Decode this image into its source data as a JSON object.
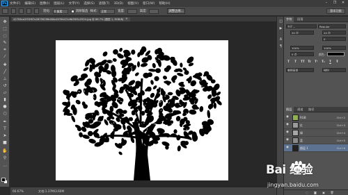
{
  "app": {
    "logo": "Ps"
  },
  "menu": [
    "文件(F)",
    "编辑(E)",
    "图像(I)",
    "图层(L)",
    "文字(Y)",
    "选择(S)",
    "滤镜(T)",
    "3D(D)",
    "视图(V)",
    "窗口(W)",
    "帮助(H)"
  ],
  "window_controls": [
    "–",
    "❐",
    "✕"
  ],
  "options": {
    "feather_label": "羽化:",
    "feather_value": "0 像素",
    "antialias_label": "消除锯齿",
    "style_label": "样式:",
    "style_value": "正常",
    "width_label": "宽度:",
    "height_label": "高度:",
    "refine_edge": "调整边缘...",
    "workspace": "基本功能"
  },
  "document": {
    "tab_title": "42706ce2f33f87e28756296d08a42f3fa1f1c6b3f05c2924.jpg @ 66.7% (图层 1, RGB/8)",
    "close": "×"
  },
  "status": {
    "zoom": "66.67%",
    "doc_size": "文档:1.37M/3.60M"
  },
  "panels": {
    "character_tabs": [
      "字符",
      "段落"
    ],
    "font_family": "方正...",
    "font_style": "Regular",
    "font_size": "20 点",
    "leading": "24 点",
    "tracking": "0",
    "scale_v": "100%",
    "scale_h": "100%",
    "baseline": "0 点",
    "color_label": "颜色:",
    "format_buttons": [
      "T",
      "T",
      "TT",
      "Tr",
      "T¹",
      "T₁",
      "T",
      "Ŧ"
    ],
    "language": "美国英语",
    "aa": "锐利",
    "layers_tabs": [
      "图层",
      "通道",
      "路径"
    ],
    "layers": [
      {
        "name": "RGB",
        "shortcut": "Ctrl+2",
        "color": "#e0e0e0"
      },
      {
        "name": "红",
        "shortcut": "Ctrl+3",
        "color": "#d0d0d0"
      },
      {
        "name": "绿",
        "shortcut": "Ctrl+4",
        "color": "#cfcfcf"
      },
      {
        "name": "蓝",
        "shortcut": "Ctrl+5",
        "color": "#cbcbcb"
      },
      {
        "name": "图层 1",
        "shortcut": "Ctrl+6",
        "color": "#f0f0f0"
      }
    ]
  },
  "watermark": {
    "brand": "Bai  经验",
    "url": "jingyan.baidu.com"
  },
  "colors": {
    "accent": "#31a8ff",
    "selected_layer": "#5d7190",
    "canvas_bg": "#282828"
  }
}
